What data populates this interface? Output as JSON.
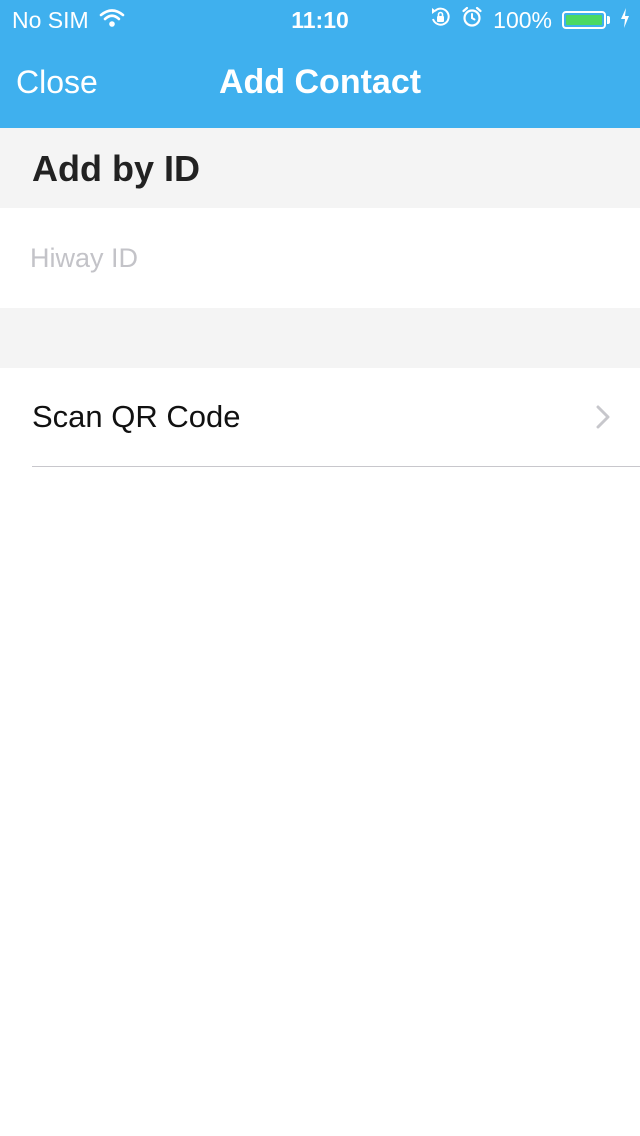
{
  "status_bar": {
    "carrier": "No SIM",
    "time": "11:10",
    "battery_percent": "100%",
    "battery_level": 1.0,
    "icons": [
      "wifi-icon",
      "rotation-lock-icon",
      "alarm-icon",
      "battery-icon",
      "charging-icon"
    ]
  },
  "nav": {
    "close_label": "Close",
    "title": "Add Contact"
  },
  "add_by_id": {
    "header": "Add by ID",
    "input_value": "",
    "input_placeholder": "Hiway ID"
  },
  "scan": {
    "label": "Scan QR Code",
    "chevron_icon": "chevron-right-icon"
  },
  "colors": {
    "accent": "#3fb0ee",
    "section_bg": "#f4f4f4",
    "battery_green": "#4cd964",
    "placeholder": "#c3c3c8"
  }
}
